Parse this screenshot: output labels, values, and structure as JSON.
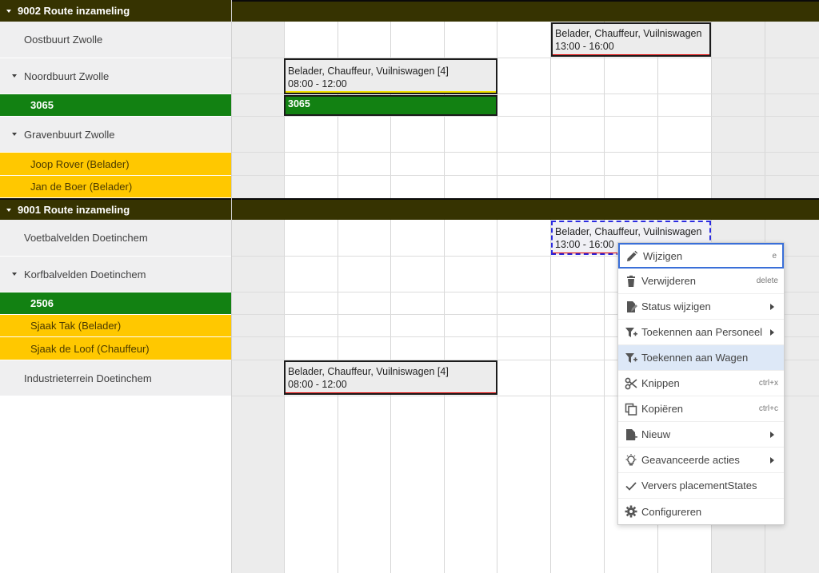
{
  "groups": [
    {
      "label": "9002 Route inzameling",
      "rows": {
        "oostbuurt": "Oostbuurt Zwolle",
        "noordbuurt": "Noordbuurt Zwolle",
        "vehicle": "3065",
        "gravenbuurt": "Gravenbuurt Zwolle",
        "person1": "Joop Rover  (Belader)",
        "person2": "Jan de Boer  (Belader)"
      }
    },
    {
      "label": "9001 Route inzameling",
      "rows": {
        "voetbal": "Voetbalvelden Doetinchem",
        "korfbal": "Korfbalvelden  Doetinchem",
        "vehicle": "2506",
        "person1": "Sjaak Tak  (Belader)",
        "person2": "Sjaak de Loof  (Chauffeur)",
        "industrie": "Industrieterrein Doetinchem"
      }
    }
  ],
  "tasks": {
    "oostbuurt": {
      "title": "Belader, Chauffeur, Vuilniswagen",
      "time": "13:00 - 16:00",
      "bar_color": "#e00000"
    },
    "noordbuurt": {
      "title": "Belader, Chauffeur, Vuilniswagen  [4]",
      "time": "08:00 - 12:00",
      "bar_color": "#f0e000"
    },
    "vehicle_3065": {
      "label": "3065"
    },
    "voetbal": {
      "title": "Belader, Chauffeur, Vuilniswagen",
      "time": "13:00 - 16:00",
      "bar_color": "#e00000"
    },
    "industrie": {
      "title": "Belader, Chauffeur, Vuilniswagen  [4]",
      "time": "08:00 - 12:00",
      "bar_color": "#e00000"
    }
  },
  "context_menu": {
    "items": [
      {
        "label": "Wijzigen",
        "shortcut": "e",
        "icon": "pencil-icon"
      },
      {
        "label": "Verwijderen",
        "shortcut": "delete",
        "icon": "trash-icon"
      },
      {
        "label": "Status wijzigen",
        "icon": "status-icon",
        "submenu": true
      },
      {
        "label": "Toekennen aan Personeel",
        "icon": "filter-plus-icon",
        "submenu": true
      },
      {
        "label": "Toekennen aan Wagen",
        "icon": "filter-plus-icon"
      },
      {
        "label": "Knippen",
        "shortcut": "ctrl+x",
        "icon": "scissors-icon"
      },
      {
        "label": "Kopiëren",
        "shortcut": "ctrl+c",
        "icon": "copy-icon"
      },
      {
        "label": "Nieuw",
        "icon": "new-file-icon",
        "submenu": true
      },
      {
        "label": "Geavanceerde acties",
        "icon": "lightbulb-icon",
        "submenu": true
      },
      {
        "label": "Ververs placementStates",
        "icon": "check-icon"
      },
      {
        "label": "Configureren",
        "icon": "gear-icon"
      }
    ]
  },
  "colors": {
    "group_header": "#363301",
    "vehicle_row": "#128112",
    "person_row": "#ffc800",
    "location_row": "#efeff0",
    "menu_hover": "#dde8f7",
    "menu_focus": "#3a6fd8"
  }
}
